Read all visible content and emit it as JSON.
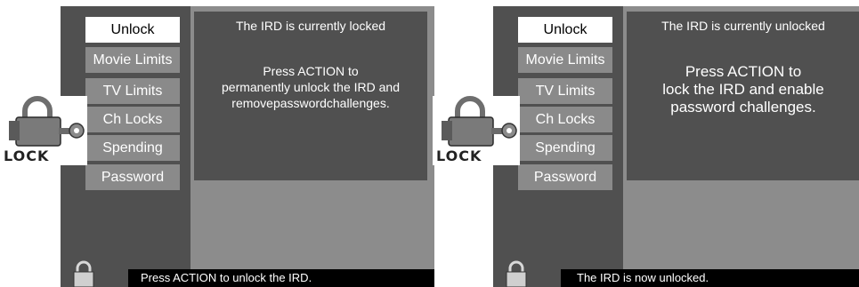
{
  "screens": [
    {
      "menu": [
        {
          "label": "Unlock",
          "selected": true
        },
        {
          "label": "Movie Limits"
        },
        {
          "label": "TV Limits"
        },
        {
          "label": "Ch Locks"
        },
        {
          "label": "Spending"
        },
        {
          "label": "Password"
        }
      ],
      "panel": {
        "status": "The IRD is currently locked",
        "message": "Press ACTION to\npermanently unlock the IRD and\nremovepasswordchallenges."
      },
      "status_bar": "Press ACTION to unlock the IRD.",
      "lock_label": "LOCK"
    },
    {
      "menu": [
        {
          "label": "Unlock",
          "selected": true
        },
        {
          "label": "Movie Limits"
        },
        {
          "label": "TV Limits"
        },
        {
          "label": "Ch Locks"
        },
        {
          "label": "Spending"
        },
        {
          "label": "Password"
        }
      ],
      "panel": {
        "status": "The IRD is currently unlocked",
        "message": "Press ACTION to\nlock the IRD and enable\npassword challenges."
      },
      "status_bar": "The IRD is now unlocked.",
      "lock_label": "LOCK"
    }
  ],
  "icons": {
    "lock_badge": "padlock-key-icon",
    "small_lock": "padlock-icon"
  }
}
